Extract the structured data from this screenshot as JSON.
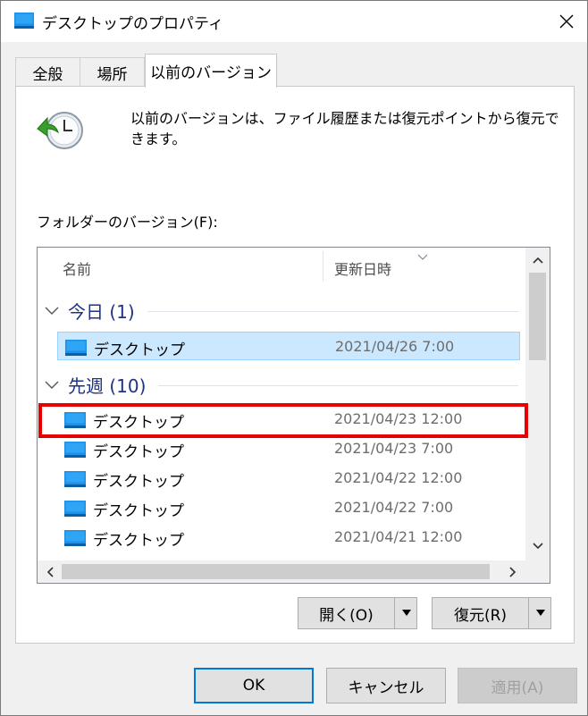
{
  "window": {
    "title": "デスクトップのプロパティ"
  },
  "tabs": [
    {
      "label": "全般"
    },
    {
      "label": "場所"
    },
    {
      "label": "以前のバージョン"
    }
  ],
  "description": "以前のバージョンは、ファイル履歴または復元ポイントから復元できます。",
  "folder_label": "フォルダーのバージョン(F):",
  "columns": {
    "name": "名前",
    "date": "更新日時"
  },
  "groups": [
    {
      "label": "今日 (1)",
      "items": [
        {
          "name": "デスクトップ",
          "date": "2021/04/26 7:00"
        }
      ]
    },
    {
      "label": "先週 (10)",
      "items": [
        {
          "name": "デスクトップ",
          "date": "2021/04/23 12:00"
        },
        {
          "name": "デスクトップ",
          "date": "2021/04/23 7:00"
        },
        {
          "name": "デスクトップ",
          "date": "2021/04/22 12:00"
        },
        {
          "name": "デスクトップ",
          "date": "2021/04/22 7:00"
        },
        {
          "name": "デスクトップ",
          "date": "2021/04/21 12:00"
        }
      ]
    }
  ],
  "actions": {
    "open": "開く(O)",
    "restore": "復元(R)"
  },
  "buttons": {
    "ok": "OK",
    "cancel": "キャンセル",
    "apply": "適用(A)"
  },
  "colors": {
    "accent": "#0078d7",
    "highlight_box": "#e60000",
    "selection": "#cce8ff",
    "group_text": "#1e3287"
  }
}
